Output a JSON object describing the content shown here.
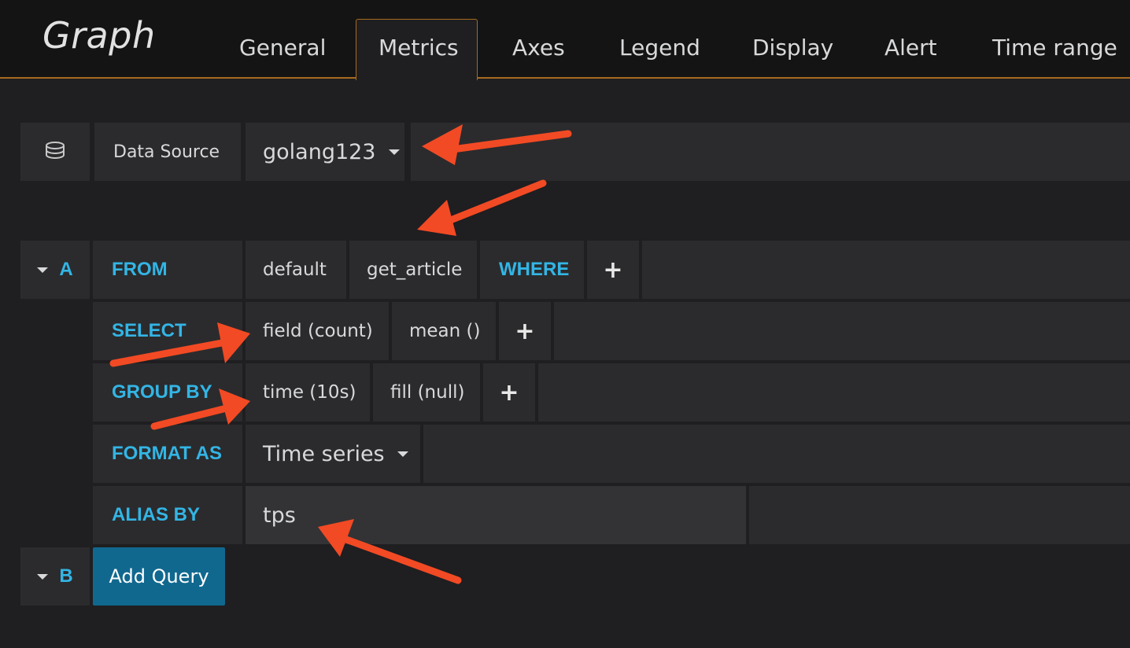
{
  "header": {
    "panel_title": "Graph",
    "tabs": [
      {
        "label": "General"
      },
      {
        "label": "Metrics"
      },
      {
        "label": "Axes"
      },
      {
        "label": "Legend"
      },
      {
        "label": "Display"
      },
      {
        "label": "Alert"
      },
      {
        "label": "Time range"
      }
    ],
    "active_tab": "Metrics"
  },
  "datasource": {
    "label": "Data Source",
    "value": "golang123",
    "icon": "database-icon"
  },
  "query_a": {
    "letter": "A",
    "from_label": "FROM",
    "from_policy": "default",
    "from_measurement": "get_article",
    "where_label": "WHERE",
    "select_label": "SELECT",
    "select_field": "field (count)",
    "select_fn": "mean ()",
    "group_by_label": "GROUP BY",
    "group_by_time": "time (10s)",
    "group_by_fill": "fill (null)",
    "format_as_label": "FORMAT AS",
    "format_as_value": "Time series",
    "alias_by_label": "ALIAS BY",
    "alias_by_value": "tps",
    "plus": "+"
  },
  "query_b": {
    "letter": "B",
    "add_query_label": "Add Query"
  },
  "colors": {
    "accent": "#33b5e5",
    "tab_border": "#a66b1e",
    "button": "#10688f",
    "annotation_arrow": "#f24a24"
  }
}
